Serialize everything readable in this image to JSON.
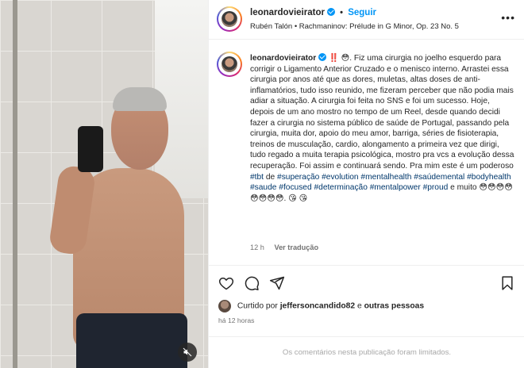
{
  "post": {
    "username": "leonardovieirator",
    "separator": "•",
    "follow_label": "Seguir",
    "audio": "Rubén Talón • Rachmaninov: Prélude in G Minor, Op. 23 No. 5",
    "more_icon": "more-horizontal-icon"
  },
  "caption": {
    "username": "leonardovieirator",
    "text_main": "‼️ 😳. Fiz uma cirurgia no joelho esquerdo para corrigir o Ligamento Anterior Cruzado e o menisco interno. Arrastei essa cirurgia por anos até que as dores, muletas, altas doses de anti-inflamatórios, tudo isso reunido, me fizeram perceber que não podia mais adiar a situação. A cirurgia foi feita no SNS e foi um sucesso. Hoje, depois de um ano mostro no tempo de um Reel, desde quando decidi fazer a cirurgia no sistema público de saúde de Portugal, passando pela cirurgia, muita dor, apoio do meu amor, barriga, séries de fisioterapia, treinos de musculação, cardio, alongamento a primeira vez que dirigi, tudo regado a muita terapia psicológica, mostro pra vcs a evolução dessa recuperação. Foi assim e continuará sendo. Pra mim este é um poderoso",
    "hashtags": [
      "#tbt",
      "#superação",
      "#evolution",
      "#mentalhealth",
      "#saúdemental",
      "#bodyhealth",
      "#saude",
      "#focused",
      "#determinação",
      "#mentalpower",
      "#proud"
    ],
    "word_de": "de",
    "word_e_muito": "e muito",
    "emoji_tail": "😳😳😳😳😳😳😳😳. 😘 😘",
    "time": "12 h",
    "translate_label": "Ver tradução"
  },
  "actions": {
    "like_icon": "heart-icon",
    "comment_icon": "comment-icon",
    "share_icon": "share-icon",
    "save_icon": "bookmark-icon"
  },
  "likes": {
    "prefix": "Curtido por",
    "user": "jeffersoncandido82",
    "suffix": "e",
    "others": "outras pessoas"
  },
  "posted": "há 12 horas",
  "comments_limited": "Os comentários nesta publicação foram limitados."
}
